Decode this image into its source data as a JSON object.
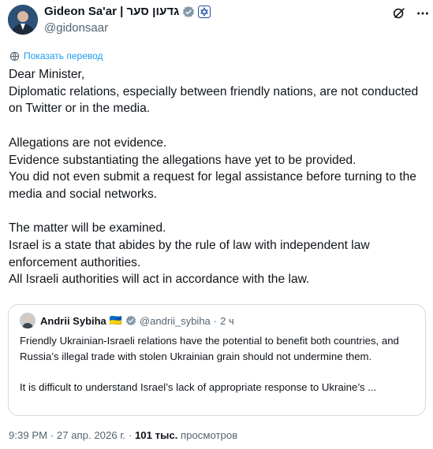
{
  "author": {
    "name": "Gideon Sa'ar | גדעון סער",
    "handle": "@gidonsaar"
  },
  "translate_label": "Показать перевод",
  "tweet": {
    "paragraphs": [
      [
        "Dear Minister,",
        "Diplomatic relations, especially between friendly nations, are not conducted on Twitter or in the media."
      ],
      [
        "Allegations are not evidence.",
        "Evidence substantiating the allegations have yet to be provided.",
        "You did not even submit a request for legal assistance before turning to the media and social networks."
      ],
      [
        "The matter will be examined.",
        "Israel is a state that abides by the rule of law with independent law enforcement authorities.",
        "All Israeli authorities will act in accordance with the law."
      ]
    ]
  },
  "quote": {
    "name": "Andrii Sybiha",
    "flag": "🇺🇦",
    "handle": "@andrii_sybiha",
    "separator": "·",
    "time": "2 ч",
    "lines": [
      "Friendly Ukrainian-Israeli relations have the potential to benefit both countries, and Russia’s illegal trade with stolen Ukrainian grain should not undermine them.",
      "",
      "It is difficult to understand Israel’s lack of appropriate response to Ukraine’s ..."
    ]
  },
  "meta": {
    "time": "9:39 PM",
    "date": "27 апр. 2026 г.",
    "views": "101 тыс.",
    "views_label": "просмотров"
  },
  "colors": {
    "text": "#0f1419",
    "secondary": "#536471",
    "link": "#1d9bf0",
    "verified_gray": "#829aab",
    "border": "#cfd9de"
  }
}
